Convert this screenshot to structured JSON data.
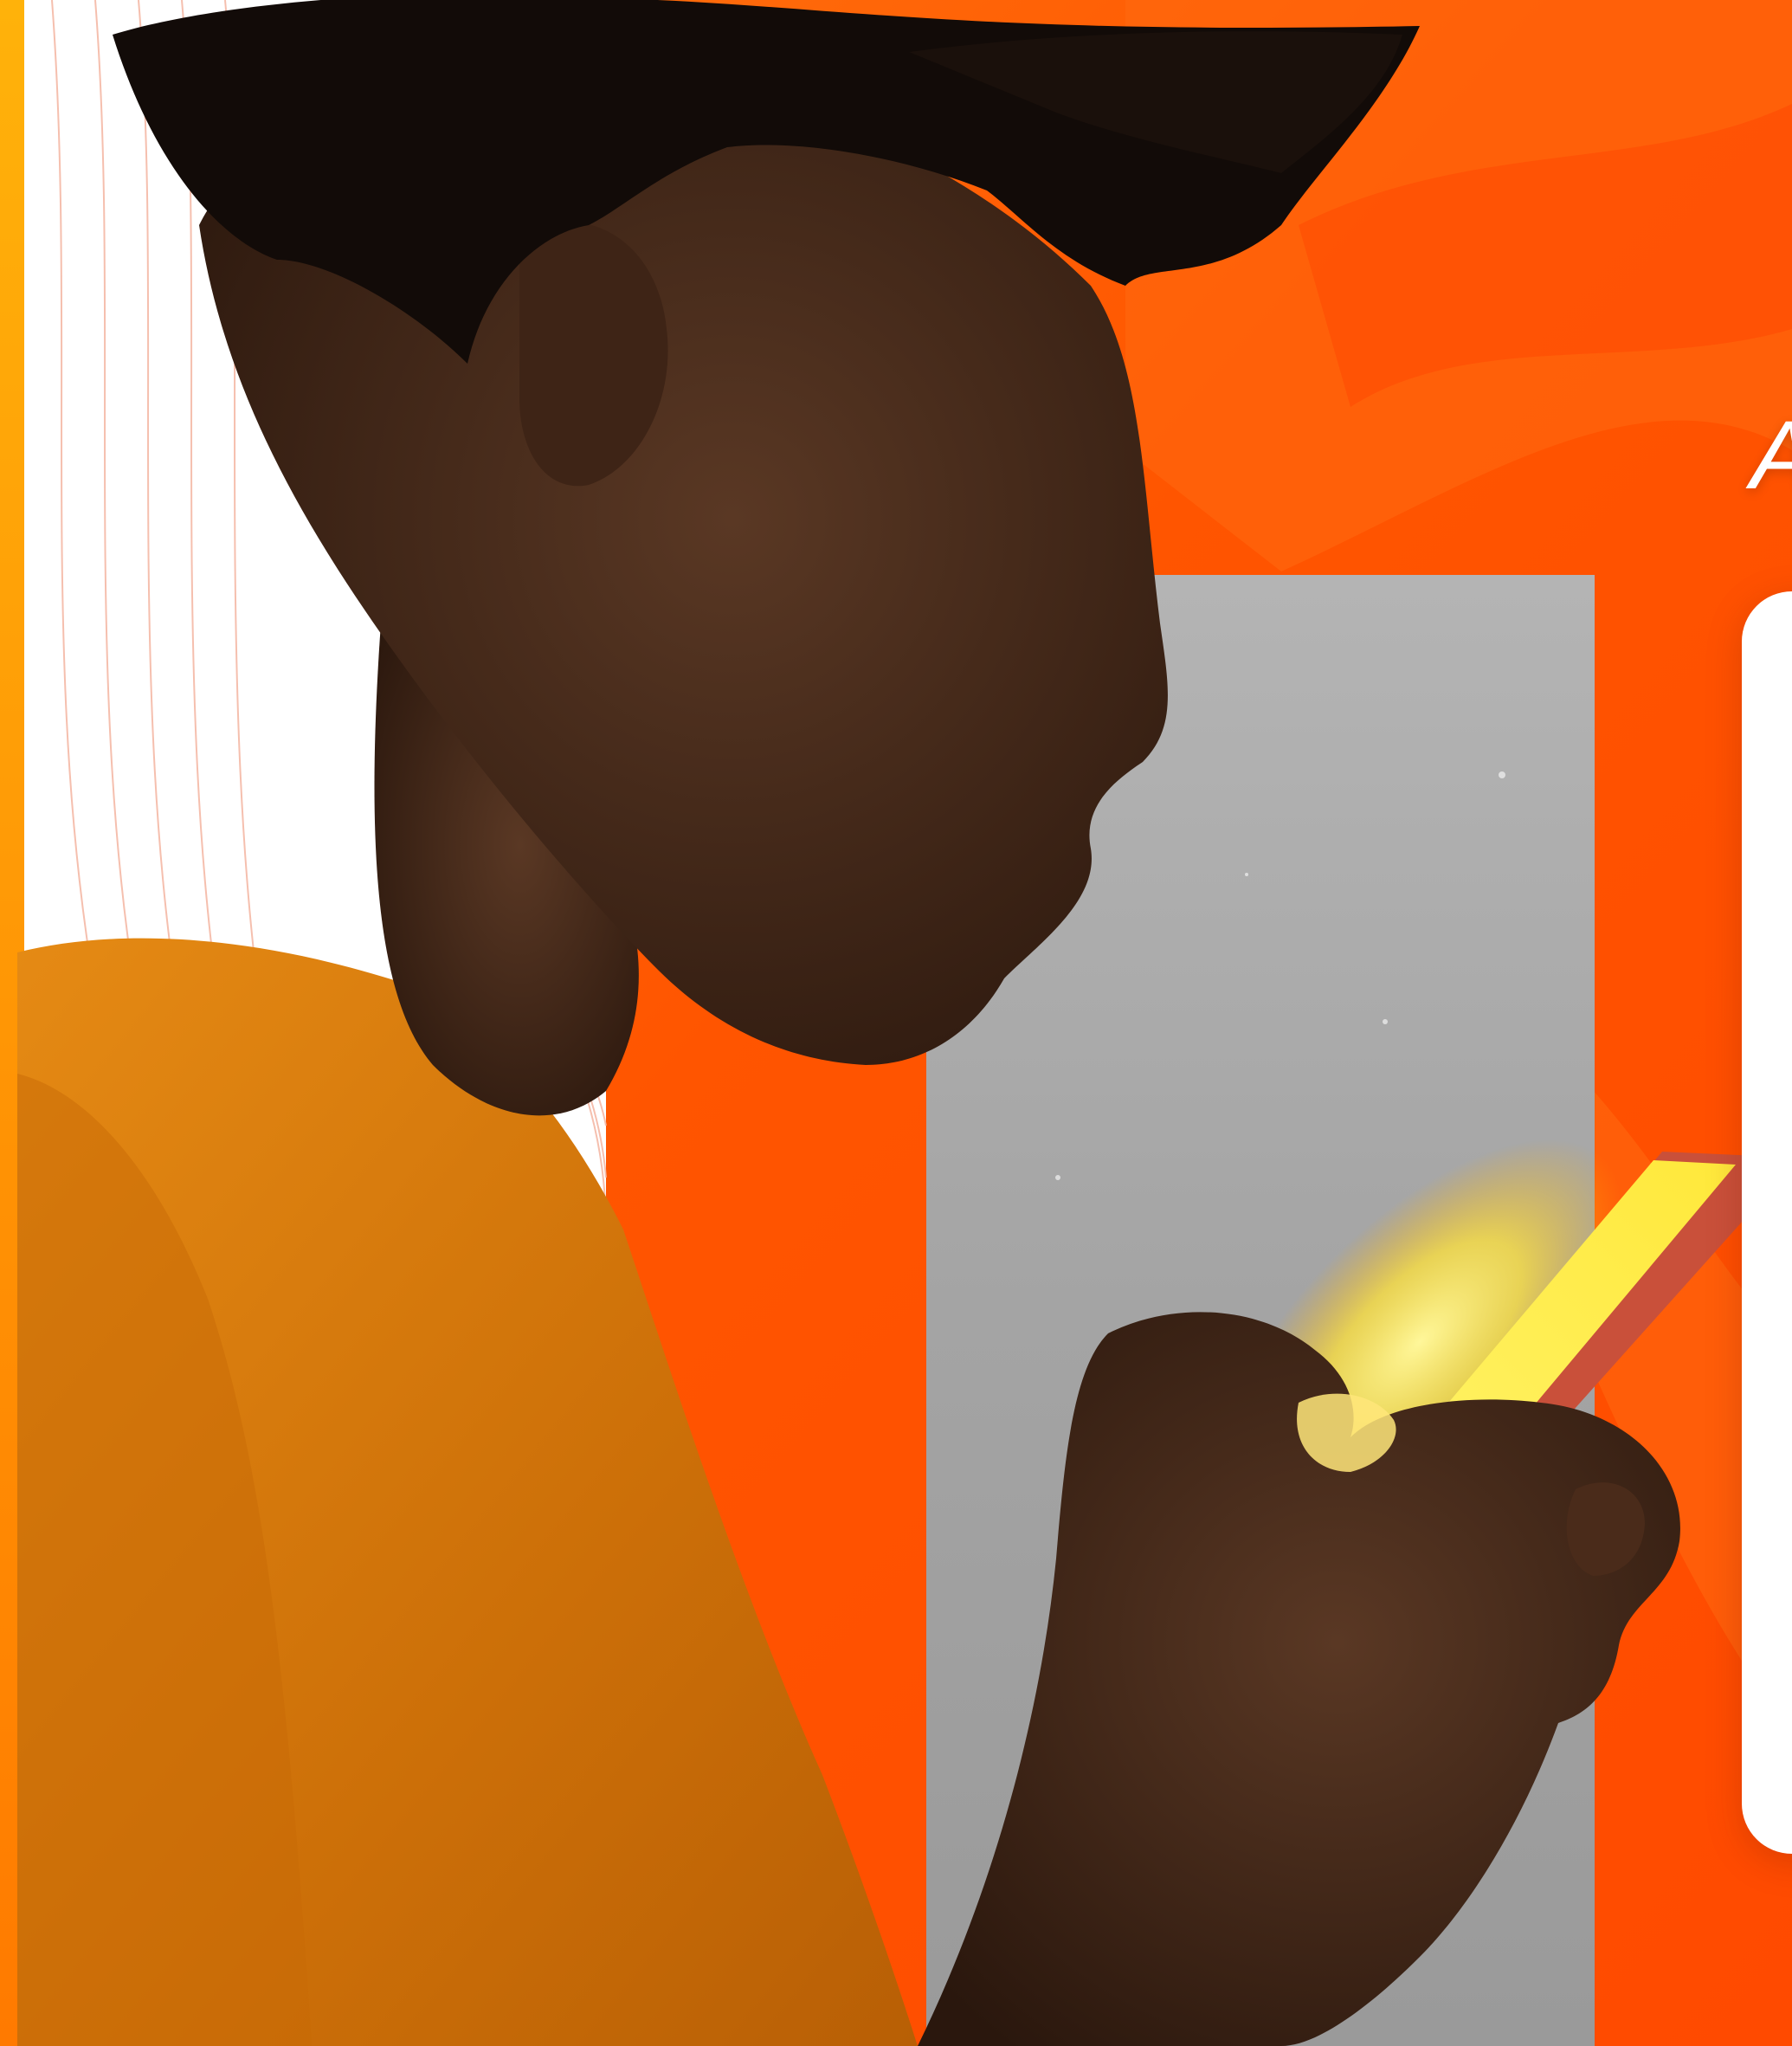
{
  "partial_text": {
    "value": "A"
  },
  "photo": {
    "subject_icon": "person-with-phone-photo",
    "palette": {
      "background_orange": "#ff5a00",
      "background_deep": "#f03a00",
      "background_light": "#ff8a1a",
      "accent_yellow": "#ffd21a",
      "panel_gray": "#a9a9a9",
      "shirt_orange": "#d9780a",
      "skin_dark": "#3a2316",
      "hair_black": "#120b08",
      "card_white": "#ffffff",
      "contour_line": "#f5b9a6"
    }
  }
}
